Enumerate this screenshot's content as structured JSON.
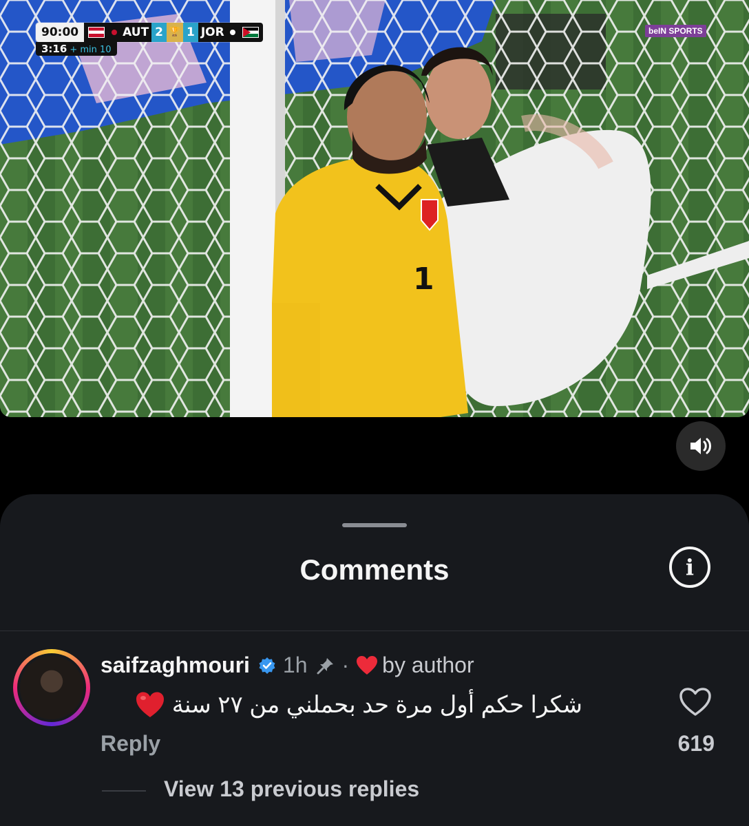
{
  "video": {
    "scoreboard": {
      "clock": "90:00",
      "home_team": "AUT",
      "home_score": "2",
      "away_score": "1",
      "away_team": "JOR",
      "added_clock": "3:16",
      "added_label": "+ min 10"
    },
    "broadcaster": "beIN SPORTS",
    "sound_icon": "speaker-volume-icon"
  },
  "comments_sheet": {
    "title": "Comments",
    "info_icon": "info-icon",
    "comment": {
      "username": "saifzaghmouri",
      "verified_icon": "verified-badge-icon",
      "time": "1h",
      "pinned_icon": "pin-icon",
      "separator": "·",
      "author_like_icon": "red-heart-icon",
      "by_author_label": "by author",
      "text": "شكرا حكم أول مرة حد بحملني من ٢٧ سنة",
      "reply_label": "Reply",
      "like_count": "619",
      "view_replies_label": "View 13 previous replies"
    }
  },
  "colors": {
    "sheet_background": "#17191d",
    "verified_blue": "#3897f0",
    "heart_red": "#ed2b3a"
  }
}
